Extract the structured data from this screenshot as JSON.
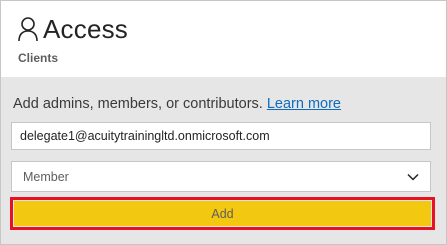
{
  "header": {
    "title": "Access",
    "subtitle": "Clients",
    "icon": "person-icon"
  },
  "form": {
    "instructions": "Add admins, members, or contributors.",
    "learn_more": "Learn more",
    "email_value": "delegate1@acuitytrainingltd.onmicrosoft.com",
    "role_value": "Member",
    "role_icon": "chevron-down-icon",
    "add_label": "Add"
  },
  "colors": {
    "add_button": "#f2c811",
    "highlight_border": "#e81123",
    "link": "#0f6cbd",
    "body_background": "#e6e6e6"
  }
}
